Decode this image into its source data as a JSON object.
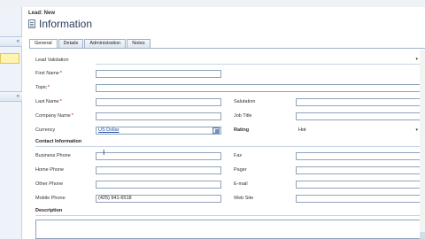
{
  "header": {
    "record_label": "Lead: New",
    "title": "Information"
  },
  "tabs": [
    {
      "label": "General",
      "active": true
    },
    {
      "label": "Details",
      "active": false
    },
    {
      "label": "Administration",
      "active": false
    },
    {
      "label": "Notes",
      "active": false
    }
  ],
  "form": {
    "lead_validation": {
      "label": "Lead Validation",
      "value": ""
    },
    "first_name": {
      "label": "First Name",
      "required": true,
      "value": ""
    },
    "topic": {
      "label": "Topic",
      "required": true,
      "value": ""
    },
    "last_name": {
      "label": "Last Name",
      "required": true,
      "value": ""
    },
    "salutation": {
      "label": "Salutation",
      "value": ""
    },
    "company_name": {
      "label": "Company Name",
      "required": true,
      "value": ""
    },
    "job_title": {
      "label": "Job Title",
      "value": ""
    },
    "currency": {
      "label": "Currency",
      "value": "US Dollar"
    },
    "rating": {
      "label": "Rating",
      "value": "Hot"
    },
    "contact_section": {
      "title": "Contact Information"
    },
    "business_phone": {
      "label": "Business Phone",
      "value": ""
    },
    "fax": {
      "label": "Fax",
      "value": ""
    },
    "home_phone": {
      "label": "Home Phone",
      "value": ""
    },
    "pager": {
      "label": "Pager",
      "value": ""
    },
    "other_phone": {
      "label": "Other Phone",
      "value": ""
    },
    "email": {
      "label": "E-mail",
      "value": ""
    },
    "mobile_phone": {
      "label": "Mobile Phone",
      "value": "(425) 941-6518"
    },
    "website": {
      "label": "Web Site",
      "value": ""
    },
    "description_section": {
      "title": "Description"
    },
    "required_mark": "*"
  },
  "icons": {
    "dropdown": "chevron-down",
    "lookup": "lookup",
    "cursor": "text-cursor"
  }
}
